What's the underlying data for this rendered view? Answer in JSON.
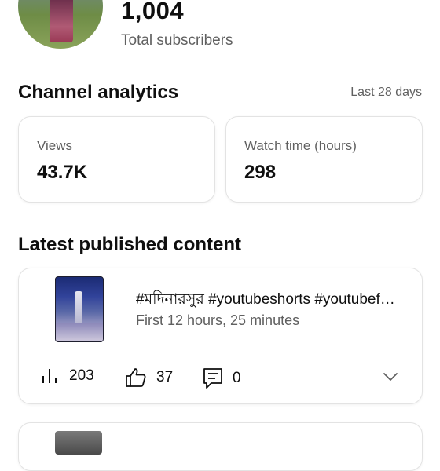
{
  "header": {
    "subscriber_count": "1,004",
    "subscriber_label": "Total subscribers"
  },
  "analytics": {
    "title": "Channel analytics",
    "range": "Last 28 days",
    "metrics": [
      {
        "label": "Views",
        "value": "43.7K"
      },
      {
        "label": "Watch time (hours)",
        "value": "298"
      }
    ]
  },
  "latest": {
    "title": "Latest published content",
    "video": {
      "title": "#মদিনারসুর #youtubeshorts #youtubefeed #viral",
      "subtitle": "First 12 hours, 25 minutes",
      "views": "203",
      "likes": "37",
      "comments": "0"
    }
  },
  "icons": {
    "views": "bar-chart-icon",
    "likes": "thumbs-up-icon",
    "comments": "comment-icon",
    "expand": "chevron-down-icon"
  }
}
